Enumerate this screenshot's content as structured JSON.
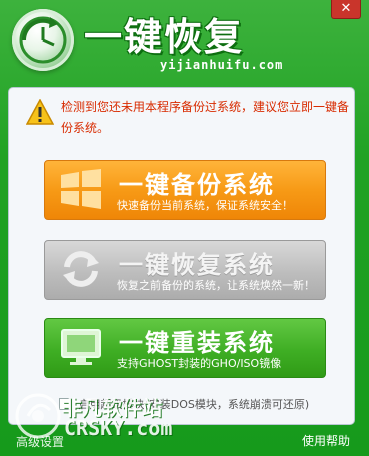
{
  "header": {
    "title": "一键恢复",
    "url": "yijianhuifu.com",
    "close_symbol": "✕"
  },
  "notice": {
    "text": "检测到您还未用本程序备份过系统，建议您立即一键备份系统。"
  },
  "buttons": [
    {
      "title": "一键备份系统",
      "subtitle": "快速备份当前系统，保证系统安全！",
      "color": "#f79a16"
    },
    {
      "title": "一键恢复系统",
      "subtitle": "恢复之前备份的系统，让系统焕然一新！",
      "color": "#bdbdbd"
    },
    {
      "title": "一键重装系统",
      "subtitle": "支持GHOST封装的GHO/ISO镜像",
      "color": "#3fae24"
    }
  ],
  "advanced": {
    "label": "启用超级模块(安装DOS模块，系统崩溃可还原)"
  },
  "footer": {
    "left_link": "高级设置",
    "help_link": "使用帮助"
  },
  "watermark": {
    "brand": "非凡软件站",
    "domain": "CRSKY.com"
  }
}
